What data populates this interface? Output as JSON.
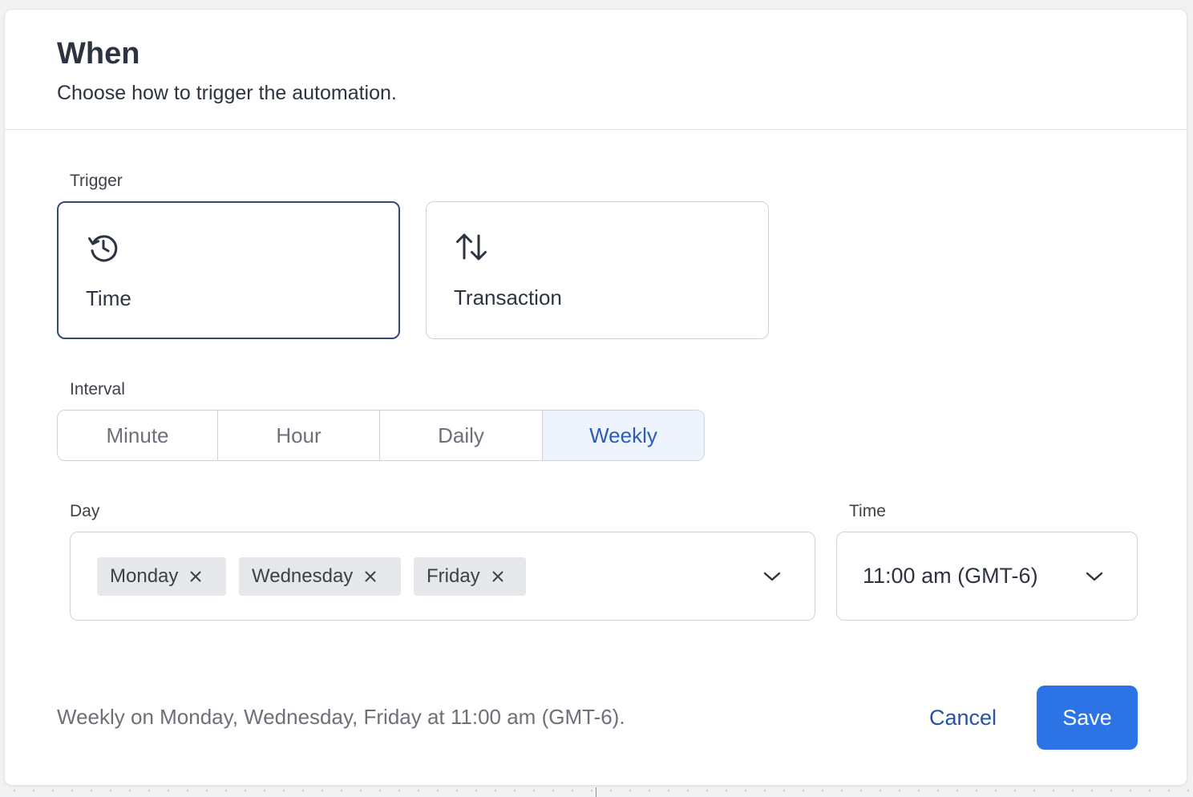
{
  "header": {
    "title": "When",
    "subtitle": "Choose how to trigger the automation."
  },
  "trigger": {
    "label": "Trigger",
    "options": [
      {
        "label": "Time",
        "icon": "clock-history-icon",
        "selected": true
      },
      {
        "label": "Transaction",
        "icon": "arrows-up-down-icon",
        "selected": false
      }
    ]
  },
  "interval": {
    "label": "Interval",
    "options": [
      "Minute",
      "Hour",
      "Daily",
      "Weekly"
    ],
    "selected": "Weekly"
  },
  "day": {
    "label": "Day",
    "chips": [
      "Monday",
      "Wednesday",
      "Friday"
    ]
  },
  "time": {
    "label": "Time",
    "value": "11:00 am (GMT-6)"
  },
  "footer": {
    "summary": "Weekly on Monday, Wednesday, Friday at 11:00 am (GMT-6).",
    "cancel_label": "Cancel",
    "save_label": "Save"
  },
  "colors": {
    "primary": "#2c74e6",
    "link": "#2452a6",
    "selected_border": "#334b73",
    "active_segment_bg": "#eef4fd"
  }
}
